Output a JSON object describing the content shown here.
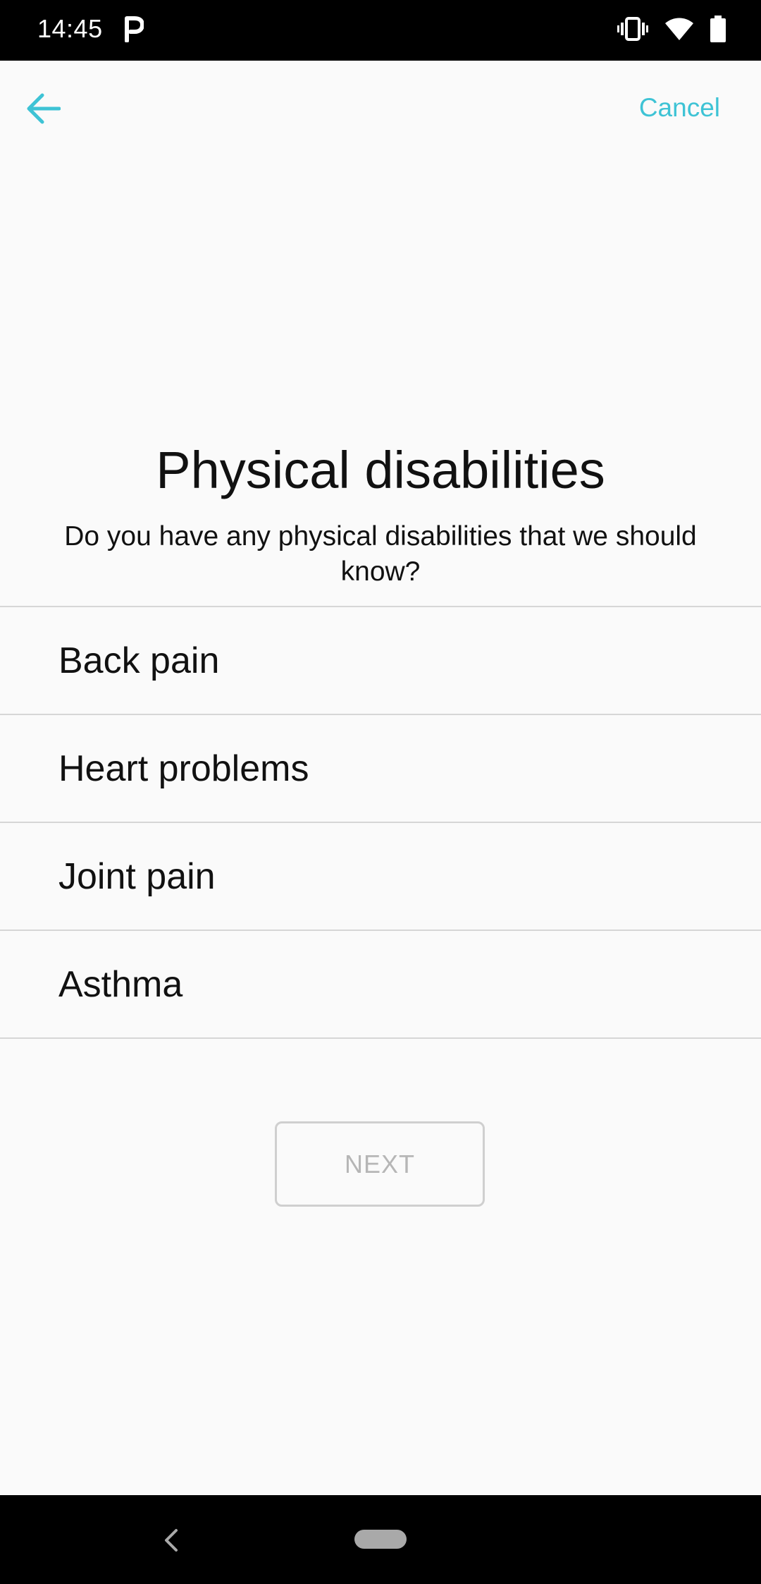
{
  "status_bar": {
    "time": "14:45",
    "icons": [
      "parking-p-icon",
      "vibrate-icon",
      "wifi-icon",
      "battery-icon"
    ]
  },
  "header": {
    "back_icon": "arrow-left-icon",
    "cancel_label": "Cancel",
    "accent_color": "#3ec3d5"
  },
  "main": {
    "title": "Physical disabilities",
    "subtitle": "Do you have any physical disabilities that we should know?",
    "options": [
      {
        "label": "Back pain"
      },
      {
        "label": "Heart problems"
      },
      {
        "label": "Joint pain"
      },
      {
        "label": "Asthma"
      }
    ],
    "next_label": "NEXT"
  },
  "nav_bar": {
    "icons": [
      "nav-back-icon",
      "home-pill-icon"
    ]
  }
}
